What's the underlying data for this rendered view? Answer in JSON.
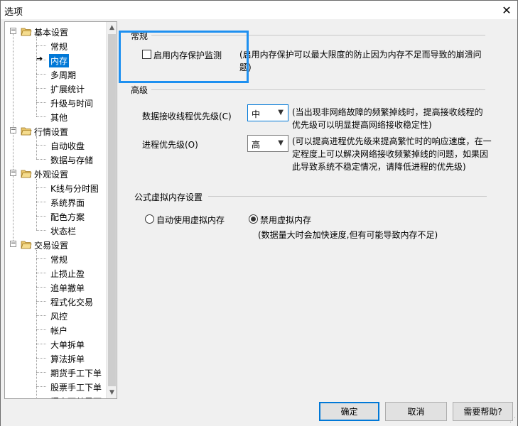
{
  "window": {
    "title": "选项",
    "close_glyph": "✕"
  },
  "tree": {
    "groups": [
      {
        "label": "基本设置",
        "items": [
          "常规",
          "内存",
          "多周期",
          "扩展统计",
          "升级与时间",
          "其他"
        ]
      },
      {
        "label": "行情设置",
        "items": [
          "自动收盘",
          "数据与存储"
        ]
      },
      {
        "label": "外观设置",
        "items": [
          "K线与分时图",
          "系统界面",
          "配色方案",
          "状态栏"
        ]
      },
      {
        "label": "交易设置",
        "items": [
          "常规",
          "止损止盈",
          "追单撤单",
          "程式化交易",
          "风控",
          "帐户",
          "大单拆单",
          "算法拆单",
          "期货手工下单",
          "股票手工下单",
          "闪电下单界面"
        ]
      }
    ],
    "selected": "内存",
    "expander_glyph": "−",
    "scroll_up_glyph": "▲",
    "scroll_down_glyph": "▼"
  },
  "memory_panel": {
    "normal_section": "常规",
    "protect_checkbox_label": "启用内存保护监测",
    "protect_checkbox_checked": false,
    "protect_note": "(启用内存保护可以最大限度的防止因为内存不足而导致的崩溃问题)",
    "advanced_section": "高级",
    "recv_priority_label": "数据接收线程优先级(C)",
    "recv_priority_value": "中",
    "recv_priority_note": "(当出现非网络故障的频繁掉线时，提高接收线程的优先级可以明显提高网络接收稳定性)",
    "proc_priority_label": "进程优先级(O)",
    "proc_priority_value": "高",
    "proc_priority_note": "(可以提高进程优先级来提高繁忙时的响应速度，在一定程度上可以解决网络接收频繁掉线的问题，如果因此导致系统不稳定情况，请降低进程的优先级)",
    "vmem_section": "公式虚拟内存设置",
    "vmem_auto_label": "自动使用虚拟内存",
    "vmem_disable_label": "禁用虚拟内存",
    "vmem_selected": "禁用虚拟内存",
    "vmem_note": "(数据量大时会加快速度,但有可能导致内存不足)"
  },
  "buttons": {
    "ok": "确定",
    "cancel": "取消",
    "help": "需要帮助?"
  },
  "colors": {
    "highlight": "#1e90f0",
    "selection": "#0078d7",
    "folder": "#e8c56a"
  }
}
